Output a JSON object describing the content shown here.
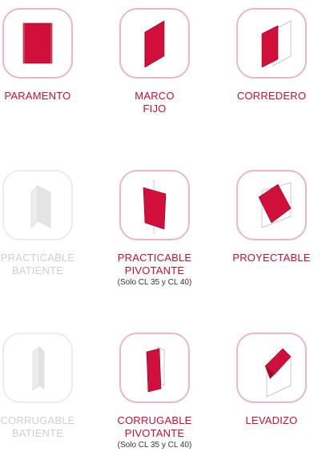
{
  "colors": {
    "accent": "#c8102e",
    "tile_border": "#e8b8c4",
    "disabled_text": "#cfcfcf",
    "disabled_border": "#ececec"
  },
  "items": [
    {
      "label": "PARAMENTO",
      "enabled": true,
      "icon": "parament-panel-icon"
    },
    {
      "label": "MARCO\nFIJO",
      "enabled": true,
      "icon": "fixed-frame-icon"
    },
    {
      "label": "CORREDERO",
      "enabled": true,
      "icon": "sliding-door-icon"
    },
    {
      "label": "PRACTICABLE\nBATIENTE",
      "enabled": false,
      "icon": "hinged-door-icon"
    },
    {
      "label": "PRACTICABLE\nPIVOTANTE",
      "note": "(Solo CL 35 y CL 40)",
      "enabled": true,
      "icon": "pivot-door-icon"
    },
    {
      "label": "PROYECTABLE",
      "enabled": true,
      "icon": "projecting-window-icon"
    },
    {
      "label": "CORRUGABLE\nBATIENTE",
      "enabled": false,
      "icon": "folding-hinged-door-icon"
    },
    {
      "label": "CORRUGABLE\nPIVOTANTE",
      "note": "(Solo CL 35 y CL 40)",
      "enabled": true,
      "icon": "folding-pivot-door-icon"
    },
    {
      "label": "LEVADIZO",
      "enabled": true,
      "icon": "lift-up-door-icon"
    }
  ]
}
